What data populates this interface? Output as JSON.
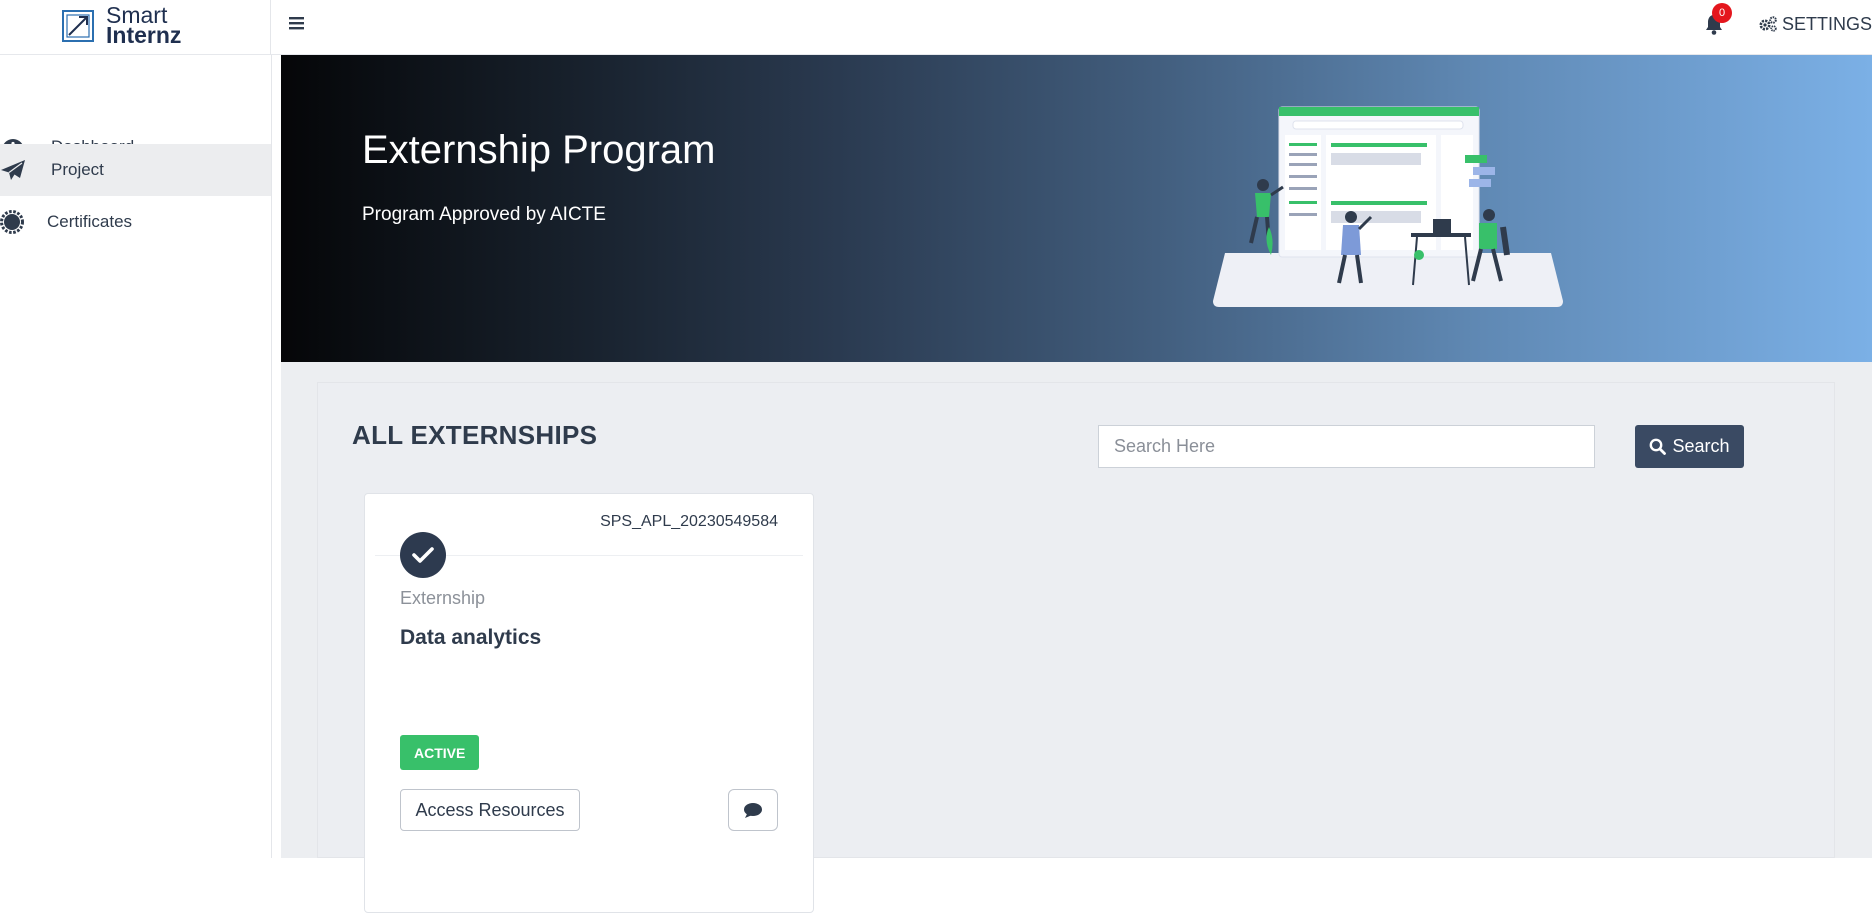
{
  "header": {
    "logo": {
      "line1": "Smart",
      "line2": "Internz"
    },
    "notifications_count": "0",
    "settings_label": "SETTINGS"
  },
  "sidebar": {
    "items": [
      {
        "label": "Dashboard",
        "icon": "dashboard-icon",
        "active": false
      },
      {
        "label": "Project",
        "icon": "paper-plane-icon",
        "active": true
      },
      {
        "label": "Certificates",
        "icon": "certificate-icon",
        "active": false
      }
    ]
  },
  "hero": {
    "title": "Externship Program",
    "subtitle": "Program Approved by AICTE"
  },
  "main": {
    "section_title": "ALL EXTERNSHIPS",
    "search": {
      "placeholder": "Search Here",
      "value": "",
      "button_label": "Search"
    }
  },
  "card": {
    "code": "SPS_APL_20230549584",
    "type": "Externship",
    "name": "Data analytics",
    "status": "ACTIVE",
    "resources_label": "Access Resources"
  },
  "colors": {
    "accent_dark": "#3a4a63",
    "status_active": "#38c06a",
    "badge_red": "#e4161d"
  }
}
